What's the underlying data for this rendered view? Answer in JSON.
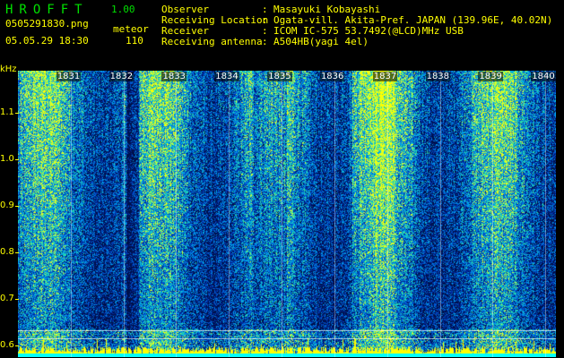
{
  "header": {
    "app_name": "HROFFT",
    "version": "1.00",
    "filename": "0505291830.png",
    "mode": "meteor",
    "datetime": "05.05.29 18:30",
    "count": "110"
  },
  "info": [
    {
      "label": "Observer",
      "value": "Masayuki Kobayashi"
    },
    {
      "label": "Receiving Location",
      "value": "Ogata-vill. Akita-Pref. JAPAN (139.96E, 40.02N)"
    },
    {
      "label": "Receiver",
      "value": "ICOM IC-575 53.7492(@LCD)MHz USB"
    },
    {
      "label": "Receiving antenna",
      "value": "A504HB(yagi 4el)"
    }
  ],
  "axis": {
    "y_unit": "kHz",
    "y_ticks": [
      "1.1",
      "1.0",
      "0.9",
      "0.8",
      "0.7",
      "0.6"
    ],
    "y_values": [
      1.1,
      1.0,
      0.9,
      0.8,
      0.7,
      0.6
    ],
    "ylim": [
      0.575,
      1.19
    ],
    "time_labels": [
      "1831",
      "1832",
      "1833",
      "1834",
      "1835",
      "1836",
      "1837",
      "1838",
      "1839",
      "1840"
    ],
    "time_minutes": [
      31,
      32,
      33,
      34,
      35,
      36,
      37,
      38,
      39,
      40
    ],
    "xlim_minutes": [
      30,
      40.2
    ]
  },
  "colors": {
    "text": "#ffff00",
    "logo": "#00e000",
    "spectrogram_low": "#00104a",
    "spectrogram_high": "#ffff00"
  }
}
